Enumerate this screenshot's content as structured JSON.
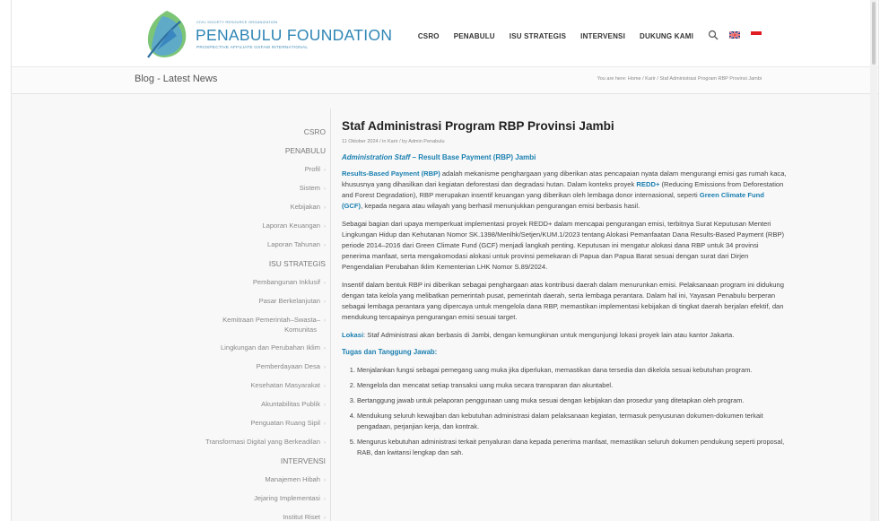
{
  "logo": {
    "small_text": "CIVIL SOCIETY RESOURCE ORGANIZATION",
    "title": "PENABULU FOUNDATION",
    "subtitle": "PROSPECTIVE AFFILIATE OXFAM INTERNATIONAL"
  },
  "nav": {
    "items": [
      "CSRO",
      "PENABULU",
      "ISU STRATEGIS",
      "INTERVENSI",
      "DUKUNG KAMI"
    ],
    "search_icon": "search-icon",
    "flags": [
      "uk-flag-icon",
      "indonesia-flag-icon"
    ]
  },
  "titlebar": {
    "title": "Blog - Latest News",
    "breadcrumb": "You are here:  Home  /  Karir  /  Staf Administrasi Program RBP Provinsi Jambi"
  },
  "sidebar": {
    "items": [
      {
        "label": "CSRO",
        "cat": true
      },
      {
        "label": "PENABULU",
        "cat": true
      },
      {
        "label": "Profil",
        "cat": false
      },
      {
        "label": "Sistem",
        "cat": false
      },
      {
        "label": "Kebijakan",
        "cat": false
      },
      {
        "label": "Laporan Keuangan",
        "cat": false
      },
      {
        "label": "Laporan Tahunan",
        "cat": false
      },
      {
        "label": "ISU STRATEGIS",
        "cat": true
      },
      {
        "label": "Pembangunan Inklusif",
        "cat": false
      },
      {
        "label": "Pasar Berkelanjutan",
        "cat": false
      },
      {
        "label": "Kemitraan Pemerintah–Swasta–Komunitas",
        "cat": false,
        "line1": "Kemitraan Pemerintah–Swasta–",
        "line2": "Komunitas"
      },
      {
        "label": "Lingkungan dan Perubahan Iklim",
        "cat": false
      },
      {
        "label": "Pemberdayaan Desa",
        "cat": false
      },
      {
        "label": "Kesehatan Masyarakat",
        "cat": false
      },
      {
        "label": "Akuntabilitas Publik",
        "cat": false
      },
      {
        "label": "Penguatan Ruang Sipil",
        "cat": false
      },
      {
        "label": "Transformasi Digital yang Berkeadilan",
        "cat": false
      },
      {
        "label": "INTERVENSI",
        "cat": true
      },
      {
        "label": "Manajemen Hibah",
        "cat": false
      },
      {
        "label": "Jejaring Implementasi",
        "cat": false
      },
      {
        "label": "Institut Riset",
        "cat": false
      }
    ]
  },
  "post": {
    "title": "Staf Administrasi Program RBP Provinsi Jambi",
    "meta": "11 Oktober 2024  /  in Karir  /  by Admin Penabulu",
    "subhead_italic": "Administration Staff",
    "subhead_rest": " – Result Base Payment (RBP) Jambi",
    "p1_link1": "Results-Based Payment (RBP)",
    "p1_a": " adalah mekanisme penghargaan yang diberikan atas pencapaian nyata dalam mengurangi emisi gas rumah kaca, khususnya yang dihasilkan dari kegiatan deforestasi dan degradasi hutan. Dalam konteks proyek ",
    "p1_link2": "REDD+",
    "p1_b": " (Reducing Emissions from Deforestation and Forest Degradation), RBP merupakan insentif keuangan yang diberikan oleh lembaga donor internasional, seperti ",
    "p1_link3": "Green Climate Fund (GCF)",
    "p1_c": ", kepada negara atau wilayah yang berhasil menunjukkan pengurangan emisi berbasis hasil.",
    "p2": "Sebagai bagian dari upaya memperkuat implementasi proyek REDD+ dalam mencapai pengurangan emisi, terbitnya Surat Keputusan Menteri Lingkungan Hidup dan Kehutanan Nomor SK.1398/Menlhk/Setjen/KUM.1/2023 tentang Alokasi Pemanfaatan Dana Results-Based Payment (RBP) periode 2014–2016 dari Green Climate Fund (GCF) menjadi langkah penting. Keputusan ini mengatur alokasi dana RBP untuk 34 provinsi penerima manfaat, serta mengakomodasi alokasi untuk provinsi pemekaran di Papua dan Papua Barat sesuai dengan surat dari Dirjen Pengendalian Perubahan Iklim Kementerian LHK Nomor S.89/2024.",
    "p3": "Insentif dalam bentuk RBP ini diberikan sebagai penghargaan atas kontribusi daerah dalam menurunkan emisi. Pelaksanaan program ini didukung dengan tata kelola yang melibatkan pemerintah pusat, pemerintah daerah, serta lembaga perantara. Dalam hal ini, Yayasan Penabulu berperan sebagai lembaga perantara yang dipercaya untuk mengelola dana RBP, memastikan implementasi kebijakan di tingkat daerah berjalan efektif, dan mendukung tercapainya pengurangan emisi sesuai target.",
    "lokasi_label": "Lokasi",
    "lokasi_text": ": Staf Administrasi akan berbasis di Jambi, dengan kemungkinan untuk mengunjungi lokasi proyek lain atau kantor Jakarta.",
    "tugas_title": "Tugas dan Tanggung Jawab:",
    "tasks": [
      "Menjalankan fungsi sebagai pemegang uang muka jika diperlukan, memastikan dana tersedia dan dikelola sesuai kebutuhan program.",
      "Mengelola dan mencatat setiap transaksi uang muka secara transparan dan akuntabel.",
      "Bertanggung jawab untuk pelaporan penggunaan uang muka sesuai dengan kebijakan dan prosedur yang ditetapkan oleh program.",
      "Mendukung seluruh kewajiban dan kebutuhan administrasi dalam pelaksanaan kegiatan, termasuk penyusunan dokumen-dokumen terkait pengadaan, perjanjian kerja, dan kontrak.",
      "Mengurus kebutuhan administrasi terkait penyaluran dana kepada penerima manfaat, memastikan seluruh dokumen pendukung seperti proposal, RAB, dan kwitansi lengkap dan sah."
    ]
  },
  "colors": {
    "brand_blue": "#1a7fb0",
    "logo_green": "#7cc576"
  }
}
